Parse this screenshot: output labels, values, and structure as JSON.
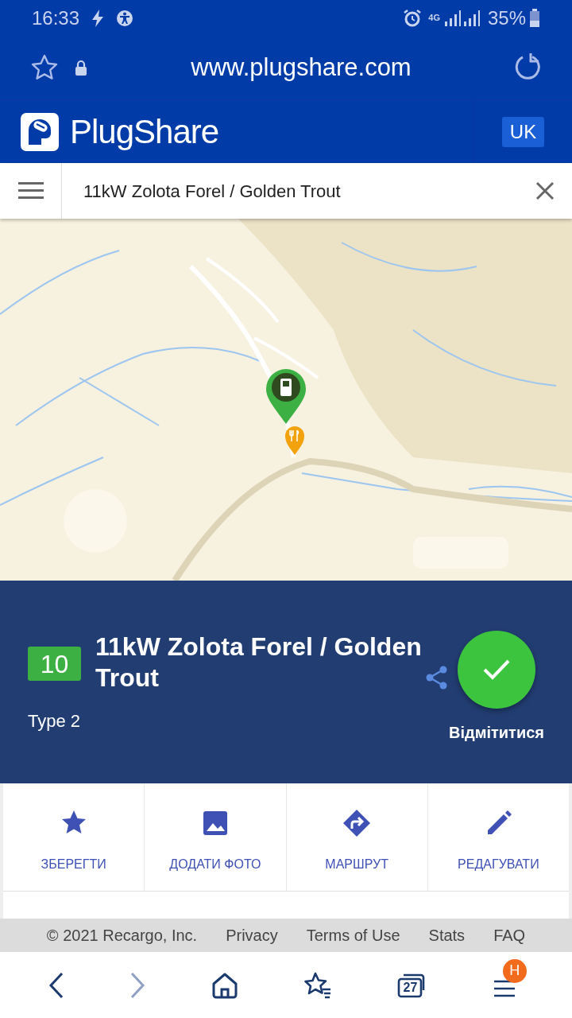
{
  "status_bar": {
    "time": "16:33",
    "network": "4G",
    "battery": "35%"
  },
  "browser": {
    "url": "www.plugshare.com",
    "tab_count": "27",
    "menu_badge": "H"
  },
  "header": {
    "brand": "PlugShare",
    "language": "UK"
  },
  "search": {
    "value": "11kW Zolota Forel / Golden Trout"
  },
  "station": {
    "score": "10",
    "title": "11kW Zolota Forel / Golden Trout",
    "connector": "Type 2",
    "checkin": "Відмітитися"
  },
  "actions": [
    {
      "kind": "save",
      "label": "ЗБЕРЕГТИ"
    },
    {
      "label": "ДОДАТИ ФОТО"
    },
    {
      "kind": "route",
      "label": "МАРШРУТ"
    },
    {
      "kind": "edit",
      "label": "РЕДАГУВАТИ"
    }
  ],
  "footer": [
    "© 2021 Recargo, Inc.",
    "Privacy",
    "Terms of Use",
    "Stats",
    "FAQ"
  ]
}
